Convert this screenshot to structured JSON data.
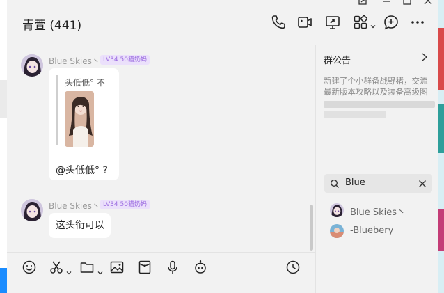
{
  "window": {
    "title": "青萱 (441)"
  },
  "titlebar_icons": [
    "phone-icon",
    "video-call-icon",
    "screen-share-icon",
    "apps-grid-icon",
    "add-chat-icon",
    "more-icon"
  ],
  "messages": [
    {
      "sender": "Blue Skies丶",
      "badge": "LV34 50猫奶妈",
      "quote": {
        "name": "头低低° 不"
      },
      "text": "@头低低° ?"
    },
    {
      "sender": "Blue Skies丶",
      "badge": "LV34 50猫奶妈",
      "text": "这头衔可以"
    }
  ],
  "toolbar": [
    "emoji-icon",
    "scissors-icon",
    "folder-icon",
    "image-icon",
    "red-packet-icon",
    "microphone-icon",
    "robot-icon",
    "clock-icon"
  ],
  "announcement": {
    "title": "群公告",
    "line1": "新建了个小群备战野猪，交流",
    "line2": "最新版本攻略以及装备高级图"
  },
  "search": {
    "query": "Blue"
  },
  "members": [
    {
      "name": "Blue Skies丶"
    },
    {
      "name": "-Bluebery"
    }
  ],
  "colors": {
    "accent": "#1a8cff",
    "badge_text": "#9b6be0",
    "badge_bg": "#ebe0fb"
  }
}
